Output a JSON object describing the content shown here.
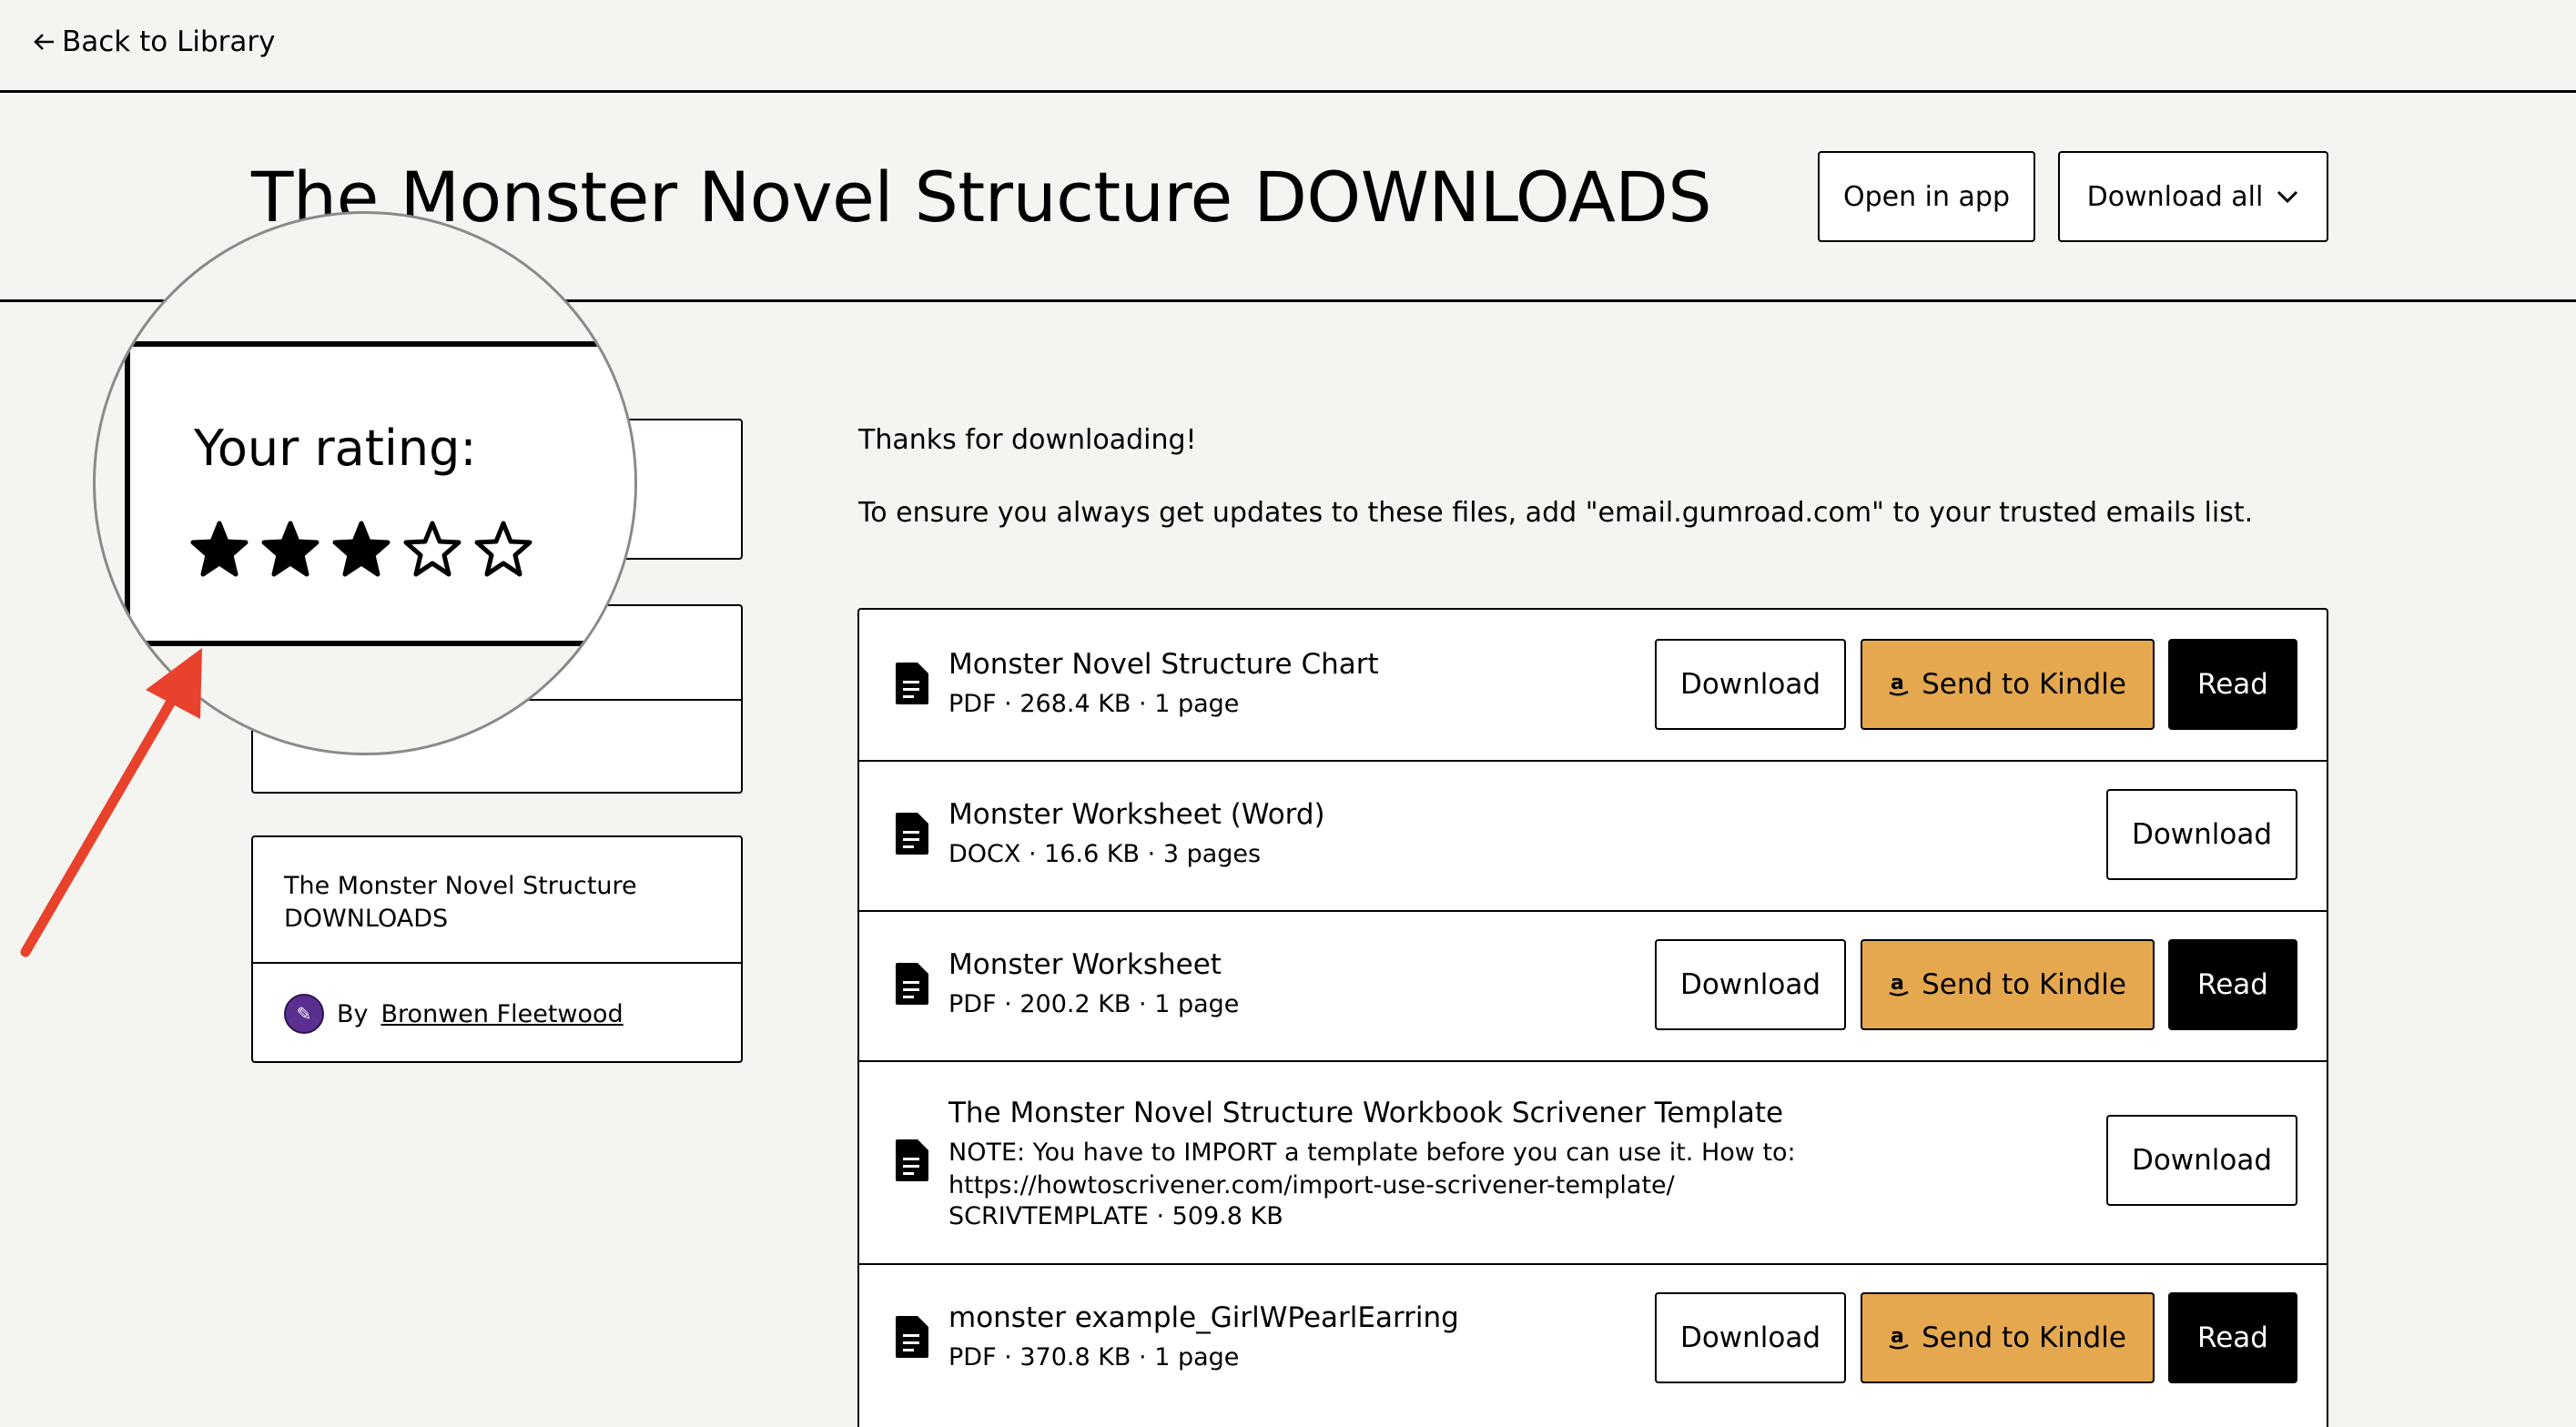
{
  "nav": {
    "back_label": "Back to Library"
  },
  "header": {
    "title": "The Monster Novel Structure DOWNLOADS",
    "open_in_app": "Open in app",
    "download_all": "Download all"
  },
  "rating": {
    "label": "Your rating:",
    "value": 3,
    "max": 5
  },
  "product": {
    "name": "The Monster Novel Structure DOWNLOADS",
    "by": "By",
    "creator": "Bronwen Fleetwood"
  },
  "content": {
    "thanks": "Thanks for downloading!",
    "trusted_note": "To ensure you always get updates to these files, add \"email.gumroad.com\" to your trusted emails list."
  },
  "buttons": {
    "download": "Download",
    "send_to_kindle": "Send to Kindle",
    "read": "Read"
  },
  "files": [
    {
      "name": "Monster Novel Structure Chart",
      "meta": "PDF · 268.4 KB · 1 page"
    },
    {
      "name": "Monster Worksheet (Word)",
      "meta": "DOCX · 16.6 KB · 3 pages"
    },
    {
      "name": "Monster Worksheet",
      "meta": "PDF · 200.2 KB · 1 page"
    },
    {
      "name": "The Monster Novel Structure Workbook Scrivener Template",
      "note_line1": "NOTE: You have to IMPORT a template before you can use it. How to:",
      "note_line2": "https://howtoscrivener.com/import-use-scrivener-template/",
      "meta": "SCRIVTEMPLATE · 509.8 KB"
    },
    {
      "name": "monster example_GirlWPearlEarring",
      "meta": "PDF · 370.8 KB · 1 page"
    }
  ],
  "colors": {
    "kindle": "#e5a84f",
    "arrow": "#e8412c",
    "background": "#f4f4f0"
  },
  "icons": [
    "arrow-left-icon",
    "chevron-down-icon",
    "file-icon",
    "amazon-icon",
    "star-icon"
  ]
}
